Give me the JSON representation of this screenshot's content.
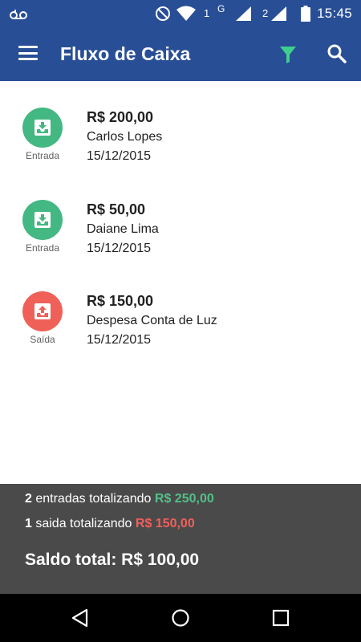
{
  "status_bar": {
    "time": "15:45",
    "sim1": "1",
    "network": "G",
    "sim2": "2",
    "icons": [
      "voicemail-icon",
      "do-not-disturb-icon",
      "wifi-icon",
      "signal-icon",
      "signal-icon",
      "battery-icon"
    ]
  },
  "app_bar": {
    "title": "Fluxo de Caixa",
    "menu_icon": "menu-icon",
    "filter_icon": "filter-icon",
    "search_icon": "search-icon"
  },
  "transactions": [
    {
      "type": "Entrada",
      "amount": "R$ 200,00",
      "name": "Carlos Lopes",
      "date": "15/12/2015",
      "icon": "income-tray-icon",
      "color": "#43b883"
    },
    {
      "type": "Entrada",
      "amount": "R$ 50,00",
      "name": "Daiane Lima",
      "date": "15/12/2015",
      "icon": "income-tray-icon",
      "color": "#43b883"
    },
    {
      "type": "Saída",
      "amount": "R$ 150,00",
      "name": "Despesa Conta de Luz",
      "date": "15/12/2015",
      "icon": "expense-tray-icon",
      "color": "#ef6158"
    }
  ],
  "summary": {
    "entradas_count": "2",
    "entradas_text": " entradas totalizando ",
    "entradas_total": "R$ 250,00",
    "saidas_count": "1",
    "saidas_text": " saida totalizando ",
    "saidas_total": "R$ 150,00",
    "saldo": "Saldo total: R$ 100,00"
  },
  "colors": {
    "primary": "#284e96",
    "income": "#43b883",
    "expense": "#ef6158",
    "summary_bg": "#4a4a4a",
    "filter_icon": "#3ecf8e"
  },
  "nav_bar": {
    "icons": [
      "back-icon",
      "home-icon",
      "recent-apps-icon"
    ]
  }
}
